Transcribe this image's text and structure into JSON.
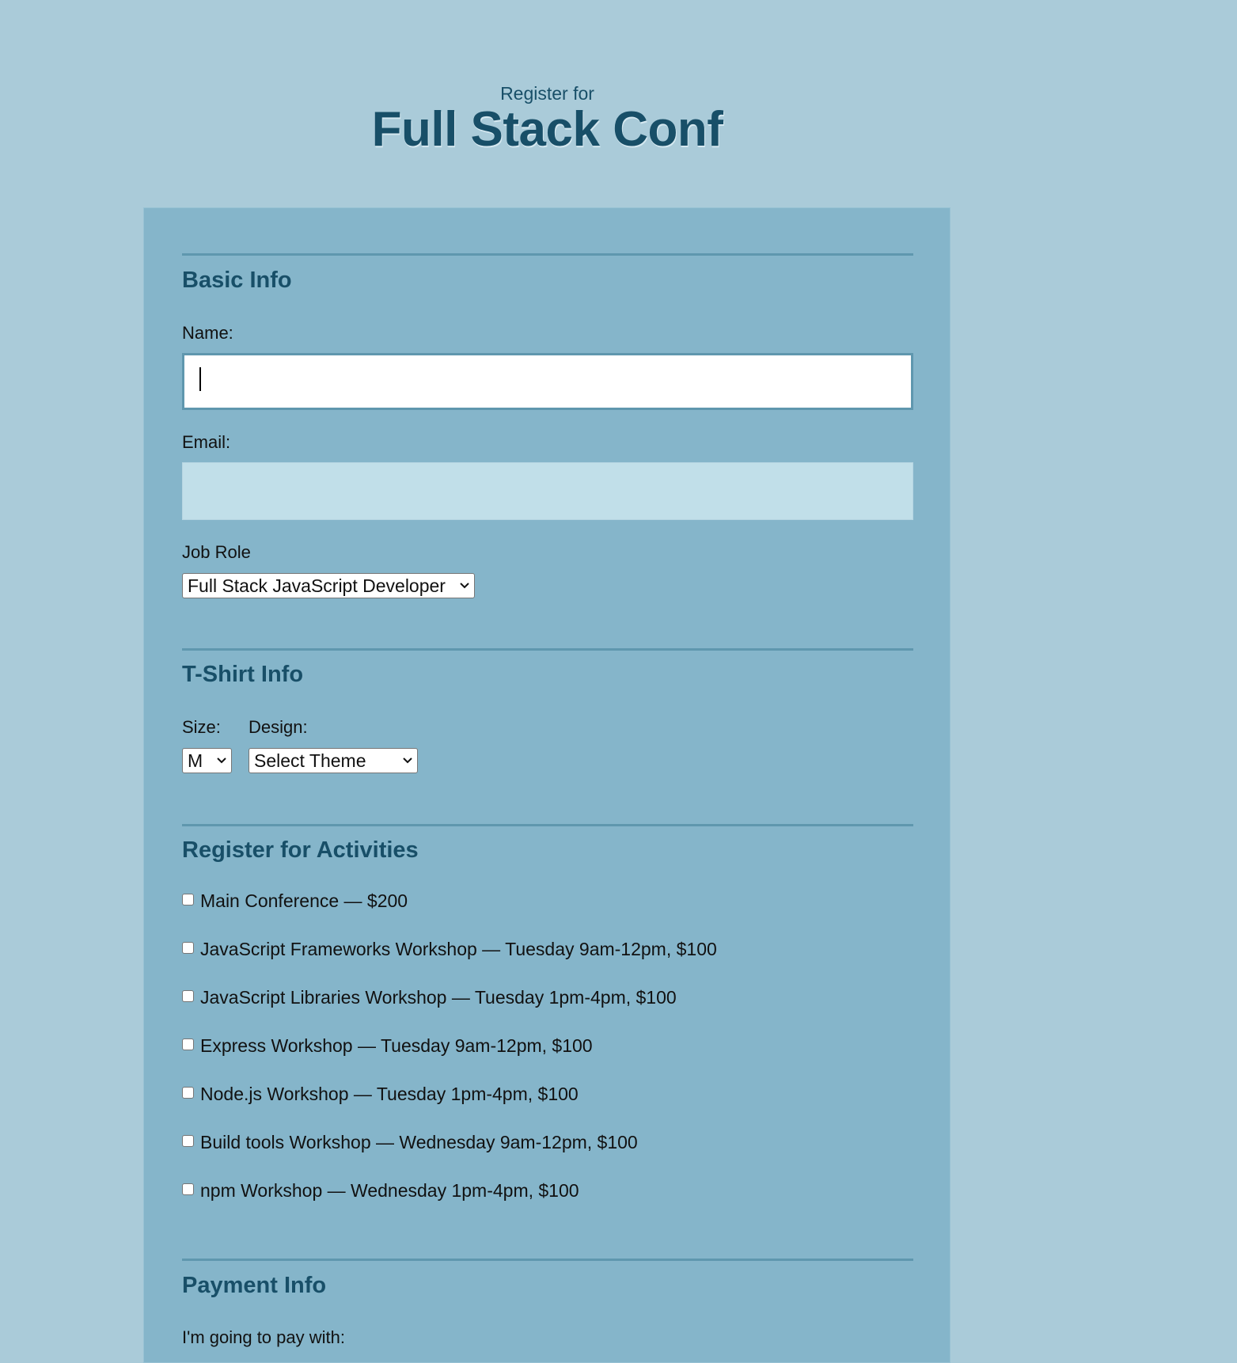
{
  "header": {
    "pretitle": "Register for",
    "title": "Full Stack Conf"
  },
  "colors": {
    "page_bg": "#aacbd9",
    "panel_bg": "#85b5ca",
    "accent": "#184f68",
    "rule": "#5f97ae",
    "email_bg": "#c1dfe9"
  },
  "basic_info": {
    "heading": "Basic Info",
    "name_label": "Name:",
    "name_value": "",
    "email_label": "Email:",
    "email_value": "",
    "job_role_label": "Job Role",
    "job_role_selected": "Full Stack JavaScript Developer"
  },
  "tshirt_info": {
    "heading": "T-Shirt Info",
    "size_label": "Size:",
    "size_selected": "M",
    "design_label": "Design:",
    "design_selected": "Select Theme"
  },
  "activities": {
    "heading": "Register for Activities",
    "items": [
      {
        "label": "Main Conference — $200",
        "checked": false
      },
      {
        "label": "JavaScript Frameworks Workshop — Tuesday 9am-12pm, $100",
        "checked": false
      },
      {
        "label": "JavaScript Libraries Workshop — Tuesday 1pm-4pm, $100",
        "checked": false
      },
      {
        "label": "Express Workshop — Tuesday 9am-12pm, $100",
        "checked": false
      },
      {
        "label": "Node.js Workshop — Tuesday 1pm-4pm, $100",
        "checked": false
      },
      {
        "label": "Build tools Workshop — Wednesday 9am-12pm, $100",
        "checked": false
      },
      {
        "label": "npm Workshop — Wednesday 1pm-4pm, $100",
        "checked": false
      }
    ]
  },
  "payment_info": {
    "heading": "Payment Info",
    "pay_with_label": "I'm going to pay with:"
  }
}
